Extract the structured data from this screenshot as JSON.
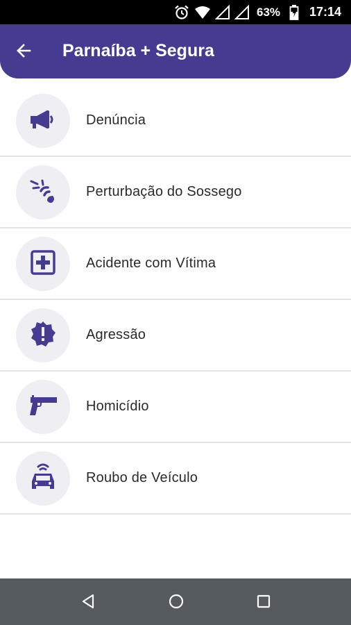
{
  "status_bar": {
    "battery_percent": "63%",
    "time": "17:14",
    "icons": [
      "alarm-icon",
      "wifi-icon",
      "signal-icon",
      "signal-icon",
      "battery-icon"
    ]
  },
  "app_bar": {
    "title": "Parnaíba + Segura",
    "back_icon": "arrow-left-icon"
  },
  "colors": {
    "primary": "#453c92",
    "icon_bg": "#eeeef3",
    "divider": "#e4e4e4",
    "nav_bar": "#555a5e"
  },
  "menu": {
    "items": [
      {
        "label": "Denúncia",
        "icon": "megaphone-icon"
      },
      {
        "label": "Perturbação do Sossego",
        "icon": "noise-icon"
      },
      {
        "label": "Acidente com Vítima",
        "icon": "medical-cross-icon"
      },
      {
        "label": "Agressão",
        "icon": "alert-badge-icon"
      },
      {
        "label": "Homicídio",
        "icon": "pistol-icon"
      },
      {
        "label": "Roubo de Veículo",
        "icon": "car-signal-icon"
      }
    ]
  },
  "nav_bar": {
    "buttons": [
      "back-triangle-icon",
      "home-circle-icon",
      "recents-square-icon"
    ]
  }
}
